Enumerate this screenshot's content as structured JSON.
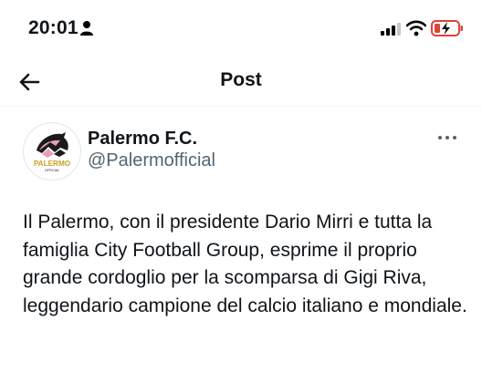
{
  "status_bar": {
    "time": "20:01",
    "icons": [
      "person-icon",
      "signal-icon",
      "wifi-icon",
      "battery-charging-icon"
    ],
    "battery_color": "#e0443a"
  },
  "header": {
    "back_icon": "arrow-left-icon",
    "title": "Post"
  },
  "post": {
    "author": {
      "name": "Palermo F.C.",
      "handle": "@Palermofficial",
      "avatar_text": "PALERMO",
      "avatar_subtext": "OFFICIAL",
      "avatar_colors": {
        "pink": "#e8a0b4",
        "black": "#1a1a1a",
        "gold": "#c9a227"
      }
    },
    "more_icon": "more-dots-icon",
    "text": "Il Palermo, con il presidente Dario Mirri e tutta la famiglia City Football Group, esprime il proprio grande cordoglio per la scomparsa di Gigi Riva, leggendario campione del calcio italiano e mondiale."
  },
  "colors": {
    "text": "#0f1419",
    "secondary": "#536471",
    "divider": "#eff3f4"
  }
}
